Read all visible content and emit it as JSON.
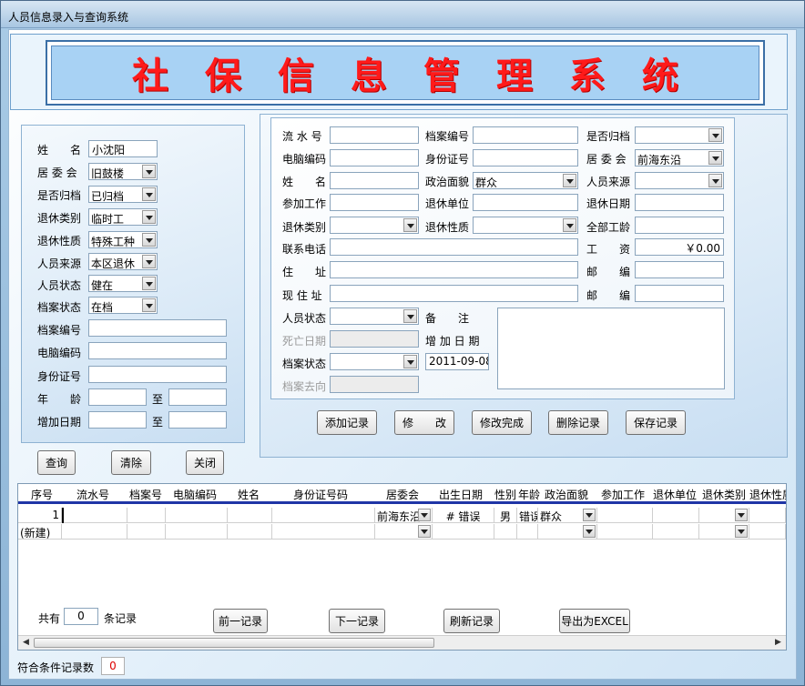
{
  "window": {
    "title": "人员信息录入与查询系统"
  },
  "banner": {
    "title": "社保信息管理系统"
  },
  "query_panel": {
    "name_label": "姓　　名",
    "name_value": "小沈阳",
    "committee_label": "居 委 会",
    "committee_value": "旧鼓楼",
    "archived_label": "是否归档",
    "archived_value": "已归档",
    "retire_type_label": "退休类别",
    "retire_type_value": "临时工",
    "retire_nature_label": "退休性质",
    "retire_nature_value": "特殊工种",
    "source_label": "人员来源",
    "source_value": "本区退休",
    "status_label": "人员状态",
    "status_value": "健在",
    "file_status_label": "档案状态",
    "file_status_value": "在档",
    "file_no_label": "档案编号",
    "pc_no_label": "电脑编码",
    "id_no_label": "身份证号",
    "age_label": "年　　龄",
    "added_date_label": "增加日期",
    "to_label": "至"
  },
  "query_buttons": {
    "query": "查询",
    "clear": "清除",
    "close": "关闭"
  },
  "form": {
    "serial_label": "流 水 号",
    "file_no_label": "档案编号",
    "archived_label": "是否归档",
    "pc_no_label": "电脑编码",
    "id_label": "身份证号",
    "committee_label": "居 委 会",
    "committee_value": "前海东沿",
    "name_label": "姓　　名",
    "political_label": "政治面貌",
    "political_value": "群众",
    "source_label": "人员来源",
    "work_start_label": "参加工作",
    "retire_unit_label": "退休单位",
    "retire_date_label": "退休日期",
    "retire_type_label": "退休类别",
    "retire_nature_label": "退休性质",
    "total_seniority_label": "全部工龄",
    "phone_label": "联系电话",
    "wage_label": "工　　资",
    "wage_value": "￥0.00",
    "address_label": "住　　址",
    "postcode_label": "邮　　编",
    "current_address_label": "现 住 址",
    "postcode2_label": "邮　　编",
    "status_label": "人员状态",
    "remark_label": "备　　注",
    "death_date_label": "死亡日期",
    "added_date_label": "增 加 日 期",
    "added_date_value": "2011-09-08",
    "file_status_label": "档案状态",
    "file_dest_label": "档案去向"
  },
  "form_buttons": {
    "add": "添加记录",
    "edit": "修　　改",
    "edit_done": "修改完成",
    "delete": "删除记录",
    "save": "保存记录"
  },
  "grid": {
    "headers": [
      "序号",
      "流水号",
      "档案号",
      "电脑编码",
      "姓名",
      "身份证号码",
      "居委会",
      "出生日期",
      "性别",
      "年龄",
      "政治面貌",
      "参加工作",
      "退休单位",
      "退休类别",
      "退休性质"
    ],
    "row1": {
      "index": "1",
      "committee": "前海东沿",
      "birth": "# 错误",
      "gender": "男",
      "age": "错误",
      "political": "群众"
    },
    "new_row_label": "(新建)"
  },
  "footer": {
    "total_prefix": "共有",
    "total_count": "0",
    "total_suffix": "条记录",
    "prev": "前一记录",
    "next": "下一记录",
    "refresh": "刷新记录",
    "export": "导出为EXCEL"
  },
  "status": {
    "label": "符合条件记录数",
    "count": "0"
  }
}
